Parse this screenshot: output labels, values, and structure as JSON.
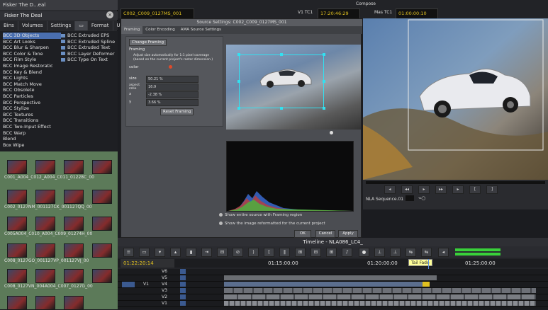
{
  "project": {
    "window_title": "Fisker The D...eal",
    "name": "Fisker The Deal",
    "tabs": [
      "Bins",
      "Volumes",
      "Settings",
      "Format",
      "Use"
    ],
    "fx_categories": [
      "BCC 3D Objects",
      "BCC Art Looks",
      "BCC Blur & Sharpen",
      "BCC Color & Tone",
      "BCC Film Style",
      "BCC Image Restoratic",
      "BCC Key & Blend",
      "BCC Lights",
      "BCC Match Move",
      "BCC Obsolete",
      "BCC Particles",
      "BCC Perspective",
      "BCC Stylize",
      "BCC Textures",
      "BCC Transitions",
      "BCC Two-Input Effect",
      "BCC Warp",
      "Blend",
      "Box Wipe"
    ],
    "fx_effects": [
      "BCC Extruded EPS",
      "BCC Extruded Spline",
      "BCC Extruded Text",
      "BCC Layer Deformer",
      "BCC Type On Text"
    ],
    "clips": [
      "C001_A004_C012_A004_C011_01228C_00",
      "C002_0127NM_001127CK_001127QQ_00",
      "C005A004_C010_A004_C009_01274H_00",
      "C008_0127GO_001127VP_001127VJ_00",
      "C008_0127VN_004A004_C007_0127G_00"
    ]
  },
  "topbar": {
    "clip_name": "C002_C009_0127MS_001",
    "source_label": "V1 TC1",
    "source_tc": "17:20:46:29",
    "compose_label": "Compose",
    "record_label": "Mas TC1",
    "record_tc": "01:00:00:10"
  },
  "dialog": {
    "title": "Source Settings: C002_C009_0127MS_001",
    "tabs": [
      "Framing",
      "Color Encoding",
      "AMA Source Settings"
    ],
    "change_framing": "Change Framing",
    "framing_label": "Framing",
    "framing_desc": "Adjust size automatically for 1:1 pixel coverage (based on the current project's raster dimension.)",
    "color_label": "color",
    "rows": [
      {
        "label": "size",
        "value": "50.21 %"
      },
      {
        "label": "aspect ratio",
        "value": "16:9"
      },
      {
        "label": "x",
        "value": "-2.38 %"
      },
      {
        "label": "y",
        "value": "3.66 %"
      }
    ],
    "reset_framing": "Reset Framing",
    "option1": "Show entire source with Framing region",
    "option2": "Show the image reformatted for the current project",
    "ok": "OK",
    "cancel": "Cancel",
    "apply": "Apply"
  },
  "monitor": {
    "sequence_label": "NLA Sequence.01"
  },
  "timeline": {
    "title": "Timeline - NLA086_LC4_",
    "current_tc": "01:22:20:14",
    "ruler": [
      "01:15:00:00",
      "01:20:00:00",
      "01:25:00:00"
    ],
    "tooltip": "Tail Fade",
    "tracks": [
      "V6",
      "V5",
      "V4",
      "V3",
      "V2",
      "V1"
    ],
    "source_track": "V1"
  },
  "colors": {
    "timecode": "#e0c020",
    "bin_green": "#5f7f5c",
    "framing_handle": "#33e0f0",
    "audio_meter": "#39d13a"
  }
}
